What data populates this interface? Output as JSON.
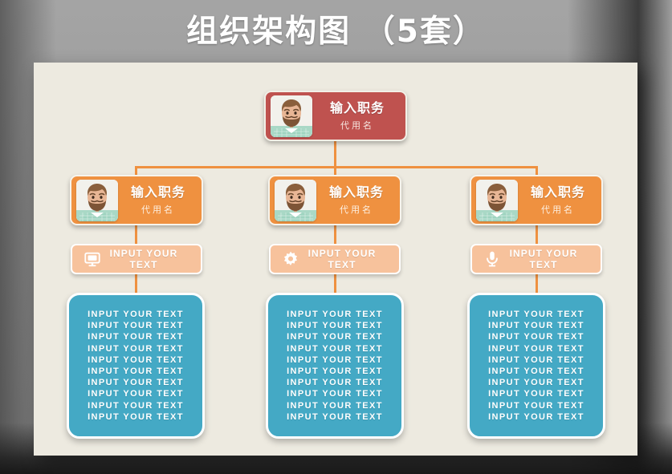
{
  "page": {
    "title": "组织架构图 （5套）",
    "background_color": "#a8a8a8",
    "panel_color": "#edeae0"
  },
  "colors": {
    "root_card": "#bf524f",
    "mid_card": "#ef9140",
    "icon_bar": "#f7c29c",
    "text_block": "#44a9c5",
    "connector": "#ef9140"
  },
  "org_chart": {
    "root": {
      "title": "输入职务",
      "subtitle": "代用名",
      "avatar": "bearded-man-avatar"
    },
    "level2": [
      {
        "title": "输入职务",
        "subtitle": "代用名",
        "avatar": "bearded-man-avatar"
      },
      {
        "title": "输入职务",
        "subtitle": "代用名",
        "avatar": "bearded-man-avatar"
      },
      {
        "title": "输入职务",
        "subtitle": "代用名",
        "avatar": "bearded-man-avatar"
      }
    ],
    "level3_bars": [
      {
        "label": "INPUT YOUR TEXT",
        "icon": "monitor-icon"
      },
      {
        "label": "INPUT YOUR TEXT",
        "icon": "gear-icon"
      },
      {
        "label": "INPUT YOUR TEXT",
        "icon": "microphone-icon"
      }
    ],
    "level4_blocks": [
      {
        "lines": [
          "INPUT YOUR TEXT",
          "INPUT YOUR TEXT",
          "INPUT YOUR TEXT",
          "INPUT YOUR TEXT",
          "INPUT YOUR TEXT",
          "INPUT YOUR TEXT",
          "INPUT YOUR TEXT",
          "INPUT YOUR TEXT",
          "INPUT YOUR TEXT",
          "INPUT YOUR TEXT"
        ]
      },
      {
        "lines": [
          "INPUT YOUR TEXT",
          "INPUT YOUR TEXT",
          "INPUT YOUR TEXT",
          "INPUT YOUR TEXT",
          "INPUT YOUR TEXT",
          "INPUT YOUR TEXT",
          "INPUT YOUR TEXT",
          "INPUT YOUR TEXT",
          "INPUT YOUR TEXT",
          "INPUT YOUR TEXT"
        ]
      },
      {
        "lines": [
          "INPUT YOUR TEXT",
          "INPUT YOUR TEXT",
          "INPUT YOUR TEXT",
          "INPUT YOUR TEXT",
          "INPUT YOUR TEXT",
          "INPUT YOUR TEXT",
          "INPUT YOUR TEXT",
          "INPUT YOUR TEXT",
          "INPUT YOUR TEXT",
          "INPUT YOUR TEXT"
        ]
      }
    ]
  }
}
